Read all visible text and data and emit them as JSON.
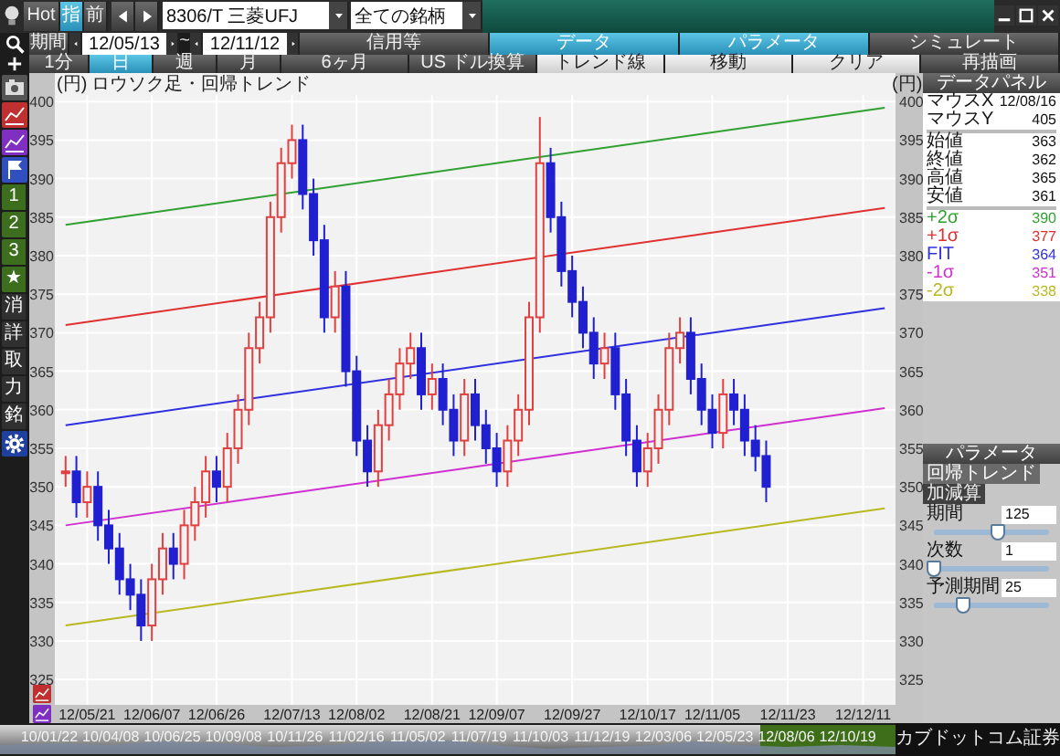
{
  "toolbar": {
    "buttons": [
      {
        "label": "Hot",
        "selected": false
      },
      {
        "label": "指",
        "selected": true
      },
      {
        "label": "前",
        "selected": false
      }
    ],
    "symbol_field": {
      "value": "8306/T 三菱UFJ"
    },
    "list_field": {
      "value": "全ての銘柄"
    }
  },
  "period": {
    "label": "期間",
    "from": "12/05/13",
    "separator": "~",
    "to": "12/11/12"
  },
  "panel_tabs": [
    {
      "label": "信用等",
      "selected": false
    },
    {
      "label": "データ",
      "selected": true
    },
    {
      "label": "パラメータ",
      "selected": true
    },
    {
      "label": "シミュレート",
      "selected": false
    }
  ],
  "interval_tabs": [
    {
      "label": "1分",
      "selected": false
    },
    {
      "label": "日",
      "selected": true
    },
    {
      "label": "週",
      "selected": false
    },
    {
      "label": "月",
      "selected": false
    },
    {
      "label": "6ヶ月",
      "selected": false
    },
    {
      "label": "US ドル換算",
      "selected": false
    }
  ],
  "tool_buttons": [
    "トレンド線",
    "移動",
    "クリア"
  ],
  "redraw_button": "再描画",
  "side_buttons": [
    {
      "label": "1",
      "kind": "marker"
    },
    {
      "label": "2",
      "kind": "marker"
    },
    {
      "label": "3",
      "kind": "marker"
    },
    {
      "label": "★",
      "kind": "marker"
    },
    {
      "label": "消",
      "kind": "command"
    },
    {
      "label": "詳",
      "kind": "command"
    },
    {
      "label": "取",
      "kind": "command"
    },
    {
      "label": "力",
      "kind": "command"
    },
    {
      "label": "銘",
      "kind": "command"
    }
  ],
  "chart": {
    "unit_left": "(円)",
    "unit_right": "(円)",
    "right_axis_labels": [
      "400",
      "395",
      "390",
      "385",
      "380",
      "375",
      "370",
      "365",
      "360",
      "355",
      "350",
      "345",
      "340",
      "335",
      "330",
      "325"
    ],
    "chart_data": {
      "type": "candlestick",
      "title": "ロウソク足・回帰トレンド",
      "ylim": [
        321.7,
        403.7
      ],
      "grid": true,
      "categories": [
        null,
        null,
        "12/05/21",
        null,
        null,
        null,
        null,
        null,
        "12/06/07",
        null,
        null,
        null,
        null,
        null,
        "12/06/26",
        null,
        null,
        null,
        null,
        null,
        null,
        "12/07/13",
        null,
        null,
        null,
        null,
        null,
        "12/08/02",
        null,
        null,
        null,
        null,
        null,
        null,
        "12/08/21",
        null,
        null,
        null,
        null,
        null,
        "12/09/07",
        null,
        null,
        null,
        null,
        null,
        null,
        "12/09/27",
        null,
        null,
        null,
        null,
        null,
        null,
        "12/10/17",
        null,
        null,
        null,
        null,
        null,
        "12/11/05",
        null,
        null,
        null,
        null,
        null,
        null,
        "12/11/23",
        null,
        null,
        null,
        null,
        null,
        null,
        "12/12/11",
        null,
        null
      ],
      "yticks": [
        325,
        330,
        335,
        340,
        345,
        350,
        355,
        360,
        365,
        370,
        375,
        380,
        385,
        390,
        395,
        400
      ],
      "ohlc": [
        [
          352,
          354,
          350,
          352
        ],
        [
          352,
          354,
          346,
          348
        ],
        [
          348,
          352,
          346,
          350
        ],
        [
          350,
          352,
          343,
          345
        ],
        [
          345,
          347,
          340,
          342
        ],
        [
          342,
          344,
          336,
          338
        ],
        [
          338,
          340,
          334,
          336
        ],
        [
          336,
          338,
          330,
          332
        ],
        [
          332,
          340,
          330,
          338
        ],
        [
          338,
          344,
          336,
          342
        ],
        [
          342,
          344,
          338,
          340
        ],
        [
          340,
          347,
          338,
          345
        ],
        [
          345,
          350,
          343,
          348
        ],
        [
          348,
          354,
          346,
          352
        ],
        [
          352,
          354,
          348,
          350
        ],
        [
          350,
          357,
          348,
          355
        ],
        [
          355,
          362,
          353,
          360
        ],
        [
          360,
          370,
          358,
          368
        ],
        [
          368,
          374,
          366,
          372
        ],
        [
          372,
          387,
          370,
          385
        ],
        [
          385,
          394,
          383,
          392
        ],
        [
          392,
          397,
          390,
          395
        ],
        [
          395,
          397,
          386,
          388
        ],
        [
          388,
          390,
          380,
          382
        ],
        [
          382,
          384,
          370,
          372
        ],
        [
          372,
          378,
          370,
          376
        ],
        [
          376,
          378,
          363,
          365
        ],
        [
          365,
          367,
          354,
          356
        ],
        [
          356,
          358,
          350,
          352
        ],
        [
          352,
          360,
          350,
          358
        ],
        [
          358,
          364,
          356,
          362
        ],
        [
          362,
          368,
          360,
          366
        ],
        [
          366,
          370,
          364,
          368
        ],
        [
          368,
          370,
          360,
          362
        ],
        [
          362,
          366,
          360,
          364
        ],
        [
          364,
          366,
          358,
          360
        ],
        [
          360,
          362,
          354,
          356
        ],
        [
          356,
          364,
          354,
          362
        ],
        [
          362,
          364,
          356,
          358
        ],
        [
          358,
          360,
          353,
          355
        ],
        [
          355,
          357,
          350,
          352
        ],
        [
          352,
          358,
          350,
          356
        ],
        [
          356,
          362,
          354,
          360
        ],
        [
          360,
          374,
          358,
          372
        ],
        [
          372,
          398,
          370,
          392
        ],
        [
          392,
          394,
          383,
          385
        ],
        [
          385,
          387,
          376,
          378
        ],
        [
          378,
          380,
          372,
          374
        ],
        [
          374,
          376,
          368,
          370
        ],
        [
          370,
          372,
          364,
          366
        ],
        [
          366,
          370,
          364,
          368
        ],
        [
          368,
          370,
          360,
          362
        ],
        [
          362,
          364,
          354,
          356
        ],
        [
          356,
          358,
          350,
          352
        ],
        [
          352,
          357,
          350,
          355
        ],
        [
          355,
          362,
          353,
          360
        ],
        [
          360,
          370,
          358,
          368
        ],
        [
          368,
          372,
          366,
          370
        ],
        [
          370,
          372,
          362,
          364
        ],
        [
          364,
          366,
          358,
          360
        ],
        [
          360,
          362,
          355,
          357
        ],
        [
          357,
          364,
          355,
          362
        ],
        [
          362,
          364,
          358,
          360
        ],
        [
          360,
          362,
          354,
          356
        ],
        [
          356,
          358,
          352,
          354
        ],
        [
          354,
          356,
          348,
          350
        ],
        null,
        null,
        null,
        null,
        null,
        null,
        null,
        null,
        null,
        null,
        null
      ]
    }
  },
  "data_panel": {
    "title": "データパネル",
    "mouse": [
      {
        "label": "マウスX",
        "value": "12/08/16"
      },
      {
        "label": "マウスY",
        "value": "405"
      }
    ],
    "prices": [
      {
        "label": "始値",
        "value": "363"
      },
      {
        "label": "終値",
        "value": "362"
      },
      {
        "label": "高値",
        "value": "365"
      },
      {
        "label": "安値",
        "value": "361"
      }
    ],
    "bands": [
      {
        "label": "+2σ",
        "value": "390",
        "color": "#30a030"
      },
      {
        "label": "+1σ",
        "value": "377",
        "color": "#e03030"
      },
      {
        "label": "FIT",
        "value": "364",
        "color": "#3030e0"
      },
      {
        "label": "-1σ",
        "value": "351",
        "color": "#d030d0"
      },
      {
        "label": "-2σ",
        "value": "338",
        "color": "#b8b820"
      }
    ]
  },
  "parameter_panel": {
    "title": "パラメータ",
    "tabs": [
      {
        "label": "回帰トレンド",
        "selected": true
      },
      {
        "label": "加減算",
        "selected": false
      }
    ],
    "params": [
      {
        "label": "期間",
        "value": "125",
        "level": 0.55
      },
      {
        "label": "次数",
        "value": "1",
        "level": 0
      },
      {
        "label": "予測期間",
        "value": "25",
        "level": 0.25
      }
    ]
  },
  "navigator": {
    "dates": [
      "10/01/22",
      "10/04/08",
      "10/06/25",
      "10/09/08",
      "10/11/26",
      "11/02/16",
      "11/05/02",
      "11/07/19",
      "11/10/03",
      "11/12/19",
      "12/03/06",
      "12/05/23",
      "12/08/06",
      "12/10/19"
    ],
    "brand": "カブドットコム証券"
  }
}
